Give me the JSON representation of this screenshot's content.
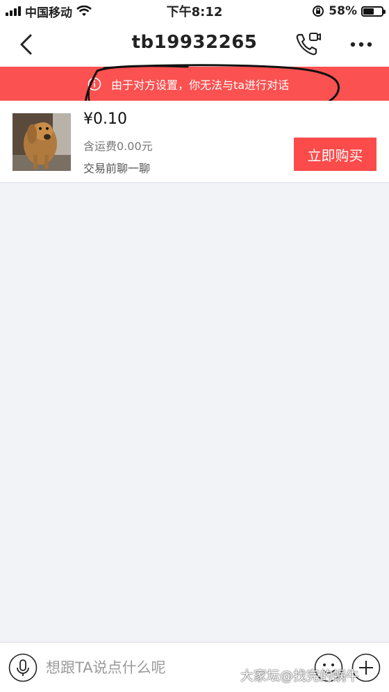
{
  "status_bar": {
    "carrier": "中国移动",
    "time": "下午8:12",
    "battery_percent_label": "58%",
    "battery_level": 0.58,
    "icons": [
      "signal-bars",
      "wifi-icon",
      "orientation-lock-icon",
      "battery-icon"
    ]
  },
  "nav": {
    "title": "tb19932265",
    "icons": [
      "back-chevron-icon",
      "voice-video-call-icon",
      "more-dots-icon"
    ]
  },
  "notice": {
    "text": "由于对方设置，你无法与ta进行对话",
    "icon": "info-circle-icon",
    "color": "#fb5151"
  },
  "product": {
    "price": "¥0.10",
    "shipping": "含运费0.00元",
    "chat_hint": "交易前聊一聊",
    "buy_label": "立即购买",
    "thumbnail": "dog-photo"
  },
  "input_bar": {
    "placeholder": "想跟TA说点什么呢",
    "icons": [
      "microphone-icon",
      "emoji-icon",
      "plus-icon"
    ]
  },
  "watermark": "大家坛@找完的蜗牛",
  "colors": {
    "accent_red": "#fb4b4b",
    "background": "#f2f3f7"
  }
}
